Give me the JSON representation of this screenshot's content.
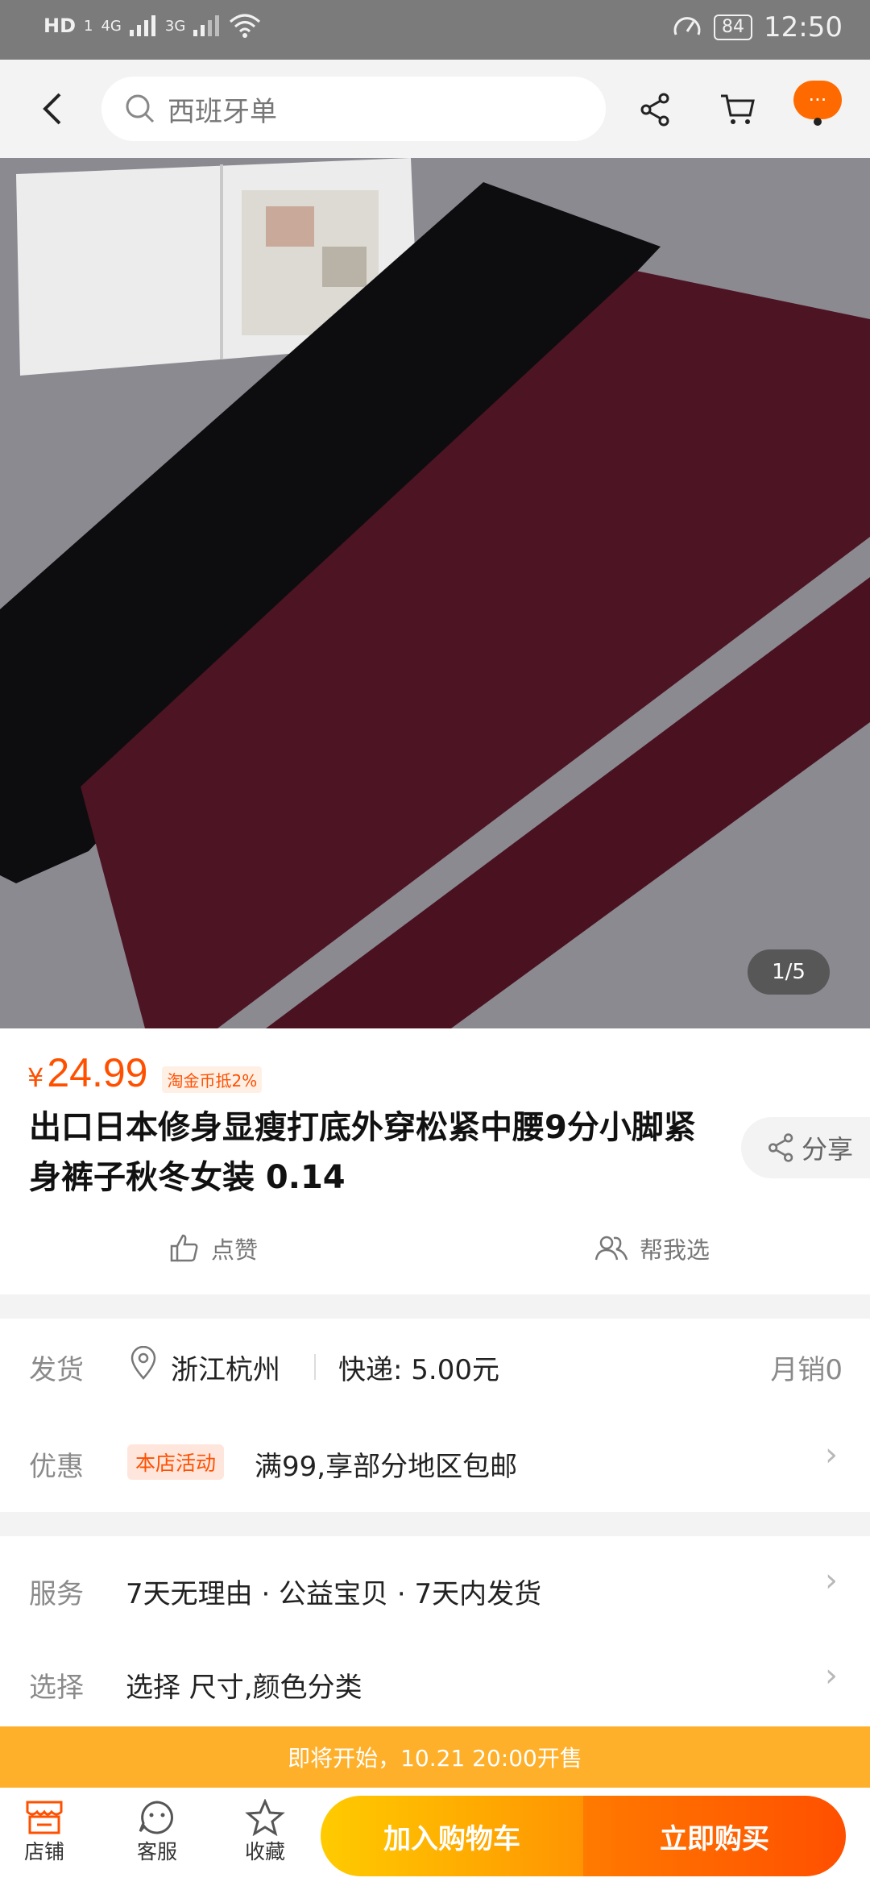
{
  "status_bar": {
    "hd": "HD",
    "sim1": "1",
    "net1": "4G",
    "net2": "3G",
    "battery": "84",
    "time": "12:50"
  },
  "search": {
    "query": "西班牙单"
  },
  "more_button": "···",
  "image": {
    "counter": "1/5"
  },
  "product": {
    "price_symbol": "¥",
    "price": "24.99",
    "coin_tag": "淘金币抵2%",
    "title": "出口日本修身显瘦打底外穿松紧中腰9分小脚紧身裤子秋冬女装 0.14",
    "share_label": "分享",
    "like_label": "点赞",
    "help_choose_label": "帮我选"
  },
  "shipping": {
    "label": "发货",
    "location": "浙江杭州",
    "express": "快递: 5.00元",
    "monthly_sales": "月销0"
  },
  "promo": {
    "label": "优惠",
    "tag": "本店活动",
    "text": "满99,享部分地区包邮"
  },
  "service": {
    "label": "服务",
    "text": "7天无理由 · 公益宝贝 · 7天内发货"
  },
  "select": {
    "label": "选择",
    "text": "选择 尺寸,颜色分类"
  },
  "banner": {
    "text": "即将开始，10.21 20:00开售"
  },
  "bottom_nav": {
    "shop": "店铺",
    "service": "客服",
    "favorite": "收藏",
    "add_cart": "加入购物车",
    "buy_now": "立即购买"
  },
  "colors": {
    "accent": "#ff5000",
    "cart_button": "#ffb300",
    "buy_button": "#ff6200",
    "banner": "#ffb02a"
  }
}
